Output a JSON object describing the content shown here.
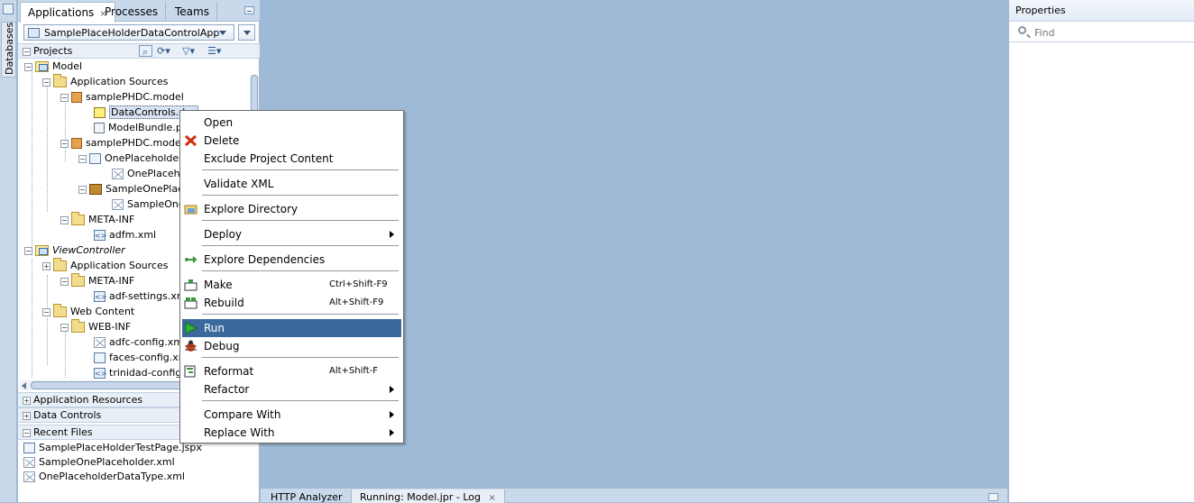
{
  "side_strip": {
    "databases_label": "Databases"
  },
  "app_panel": {
    "tabs": [
      {
        "label": "Applications",
        "close": "×"
      },
      {
        "label": "Processes"
      },
      {
        "label": "Teams"
      }
    ],
    "selected_app": "SamplePlaceHolderDataControlApp",
    "projects_label": "Projects",
    "tree": [
      {
        "label": "Model",
        "toggle": "−",
        "icon": "project-icon"
      },
      {
        "label": "Application Sources",
        "toggle": "−",
        "icon": "folder-icon"
      },
      {
        "label": "samplePHDC.model",
        "toggle": "−",
        "icon": "package-icon"
      },
      {
        "label": "DataControls.dcx",
        "icon": "data-controls-icon"
      },
      {
        "label": "ModelBundle.properties",
        "icon": "properties-file-icon"
      },
      {
        "label": "samplePHDC.model.",
        "toggle": "−",
        "icon": "package-icon"
      },
      {
        "label": "OnePlaceholderDataType",
        "toggle": "−",
        "icon": "placeholder-icon"
      },
      {
        "label": "OnePlaceholderDataType.xml",
        "icon": "xml-file-icon"
      },
      {
        "label": "SampleOnePlaceholder",
        "toggle": "−",
        "icon": "briefcase-icon"
      },
      {
        "label": "SampleOnePlaceholder.xml",
        "icon": "xml-file-icon"
      },
      {
        "label": "META-INF",
        "toggle": "−",
        "icon": "folder-icon"
      },
      {
        "label": "adfm.xml",
        "icon": "xml-file-icon"
      },
      {
        "label": "ViewController",
        "toggle": "−",
        "icon": "project-icon"
      },
      {
        "label": "Application Sources",
        "toggle": "+",
        "icon": "folder-icon"
      },
      {
        "label": "META-INF",
        "toggle": "−",
        "icon": "folder-icon"
      },
      {
        "label": "adf-settings.xml",
        "icon": "xml-file-icon"
      },
      {
        "label": "Web Content",
        "toggle": "−",
        "icon": "folder-icon"
      },
      {
        "label": "WEB-INF",
        "toggle": "−",
        "icon": "folder-icon"
      },
      {
        "label": "adfc-config.xml",
        "icon": "xml-file-icon"
      },
      {
        "label": "faces-config.xml",
        "icon": "xml-file-icon"
      },
      {
        "label": "trinidad-config.xml",
        "icon": "xml-file-icon"
      }
    ],
    "sections": {
      "application_resources": "Application Resources",
      "data_controls": "Data Controls",
      "recent_files": "Recent Files"
    },
    "recent_files": [
      {
        "label": "SamplePlaceHolderTestPage.jspx",
        "icon": "jspx-file-icon"
      },
      {
        "label": "SampleOnePlaceholder.xml",
        "icon": "xml-file-icon"
      },
      {
        "label": "OnePlaceholderDataType.xml",
        "icon": "xml-file-icon"
      }
    ]
  },
  "properties_panel": {
    "title": "Properties",
    "search_placeholder": "Find"
  },
  "log_bar": {
    "tabs": [
      {
        "label": "HTTP Analyzer"
      },
      {
        "label": "Running: Model.jpr - Log",
        "close": "×"
      }
    ]
  },
  "context_menu": {
    "items": [
      {
        "label": "Open",
        "icon": ""
      },
      {
        "label": "Delete",
        "icon": "delete-x-icon"
      },
      {
        "label": "Exclude Project Content",
        "icon": ""
      },
      {
        "label": "Validate XML",
        "icon": ""
      },
      {
        "label": "Explore Directory",
        "icon": "explore-directory-icon"
      },
      {
        "label": "Deploy",
        "icon": "",
        "submenu": true
      },
      {
        "label": "Explore Dependencies",
        "icon": "dependencies-icon"
      },
      {
        "label": "Make",
        "icon": "make-icon",
        "accelerator": "Ctrl+Shift-F9"
      },
      {
        "label": "Rebuild",
        "icon": "rebuild-icon",
        "accelerator": "Alt+Shift-F9"
      },
      {
        "label": "Run",
        "icon": "run-icon",
        "highlighted": true
      },
      {
        "label": "Debug",
        "icon": "debug-bug-icon"
      },
      {
        "label": "Reformat",
        "icon": "reformat-icon",
        "accelerator": "Alt+Shift-F"
      },
      {
        "label": "Refactor",
        "icon": "",
        "submenu": true
      },
      {
        "label": "Compare With",
        "icon": "",
        "submenu": true
      },
      {
        "label": "Replace With",
        "icon": "",
        "submenu": true
      }
    ]
  },
  "colors": {
    "workspace": "#9fbad6",
    "menu_highlight": "#3a6a9c"
  }
}
